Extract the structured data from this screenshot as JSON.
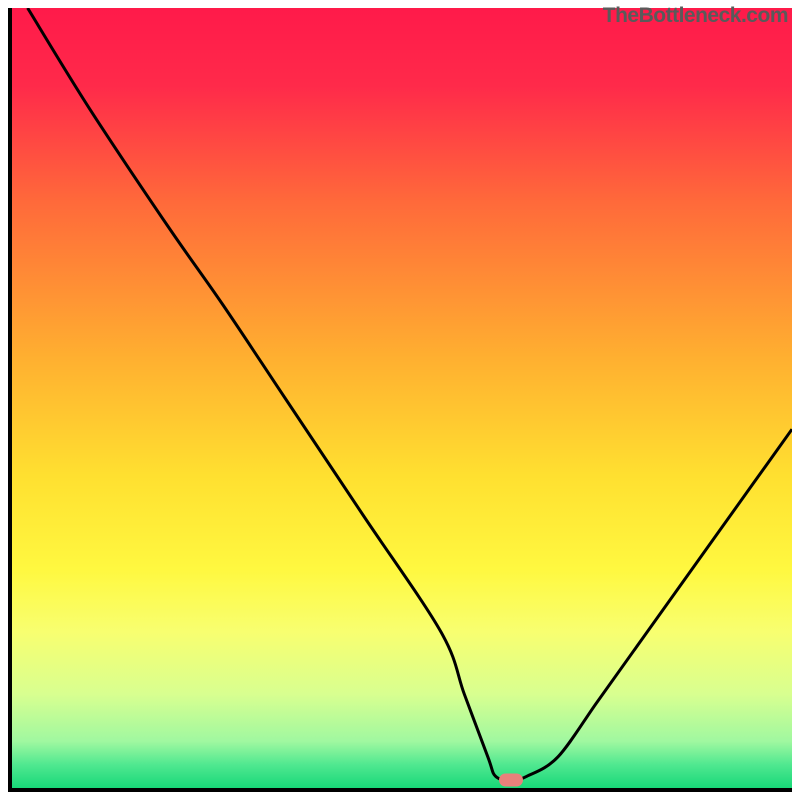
{
  "watermark": "TheBottleneck.com",
  "chart_data": {
    "type": "line",
    "title": "",
    "xlabel": "",
    "ylabel": "",
    "xlim": [
      0,
      100
    ],
    "ylim": [
      0,
      100
    ],
    "x": [
      2,
      10,
      20,
      27,
      35,
      45,
      55,
      58,
      61,
      62,
      64,
      66,
      70,
      75,
      80,
      85,
      90,
      95,
      100
    ],
    "y": [
      100,
      87,
      72,
      62,
      50,
      35,
      20,
      12,
      4,
      1.5,
      1,
      1.5,
      4,
      11,
      18,
      25,
      32,
      39,
      46
    ],
    "optimum_marker": {
      "x": 64,
      "y": 1
    },
    "gradient_stops": [
      {
        "pos": 0.0,
        "color": "#ff1a4a"
      },
      {
        "pos": 0.1,
        "color": "#ff2a4a"
      },
      {
        "pos": 0.25,
        "color": "#ff6a3a"
      },
      {
        "pos": 0.45,
        "color": "#ffb030"
      },
      {
        "pos": 0.6,
        "color": "#ffe030"
      },
      {
        "pos": 0.72,
        "color": "#fff840"
      },
      {
        "pos": 0.8,
        "color": "#f8ff70"
      },
      {
        "pos": 0.88,
        "color": "#d8ff90"
      },
      {
        "pos": 0.94,
        "color": "#a0f8a0"
      },
      {
        "pos": 0.97,
        "color": "#50e890"
      },
      {
        "pos": 1.0,
        "color": "#18d878"
      }
    ]
  }
}
